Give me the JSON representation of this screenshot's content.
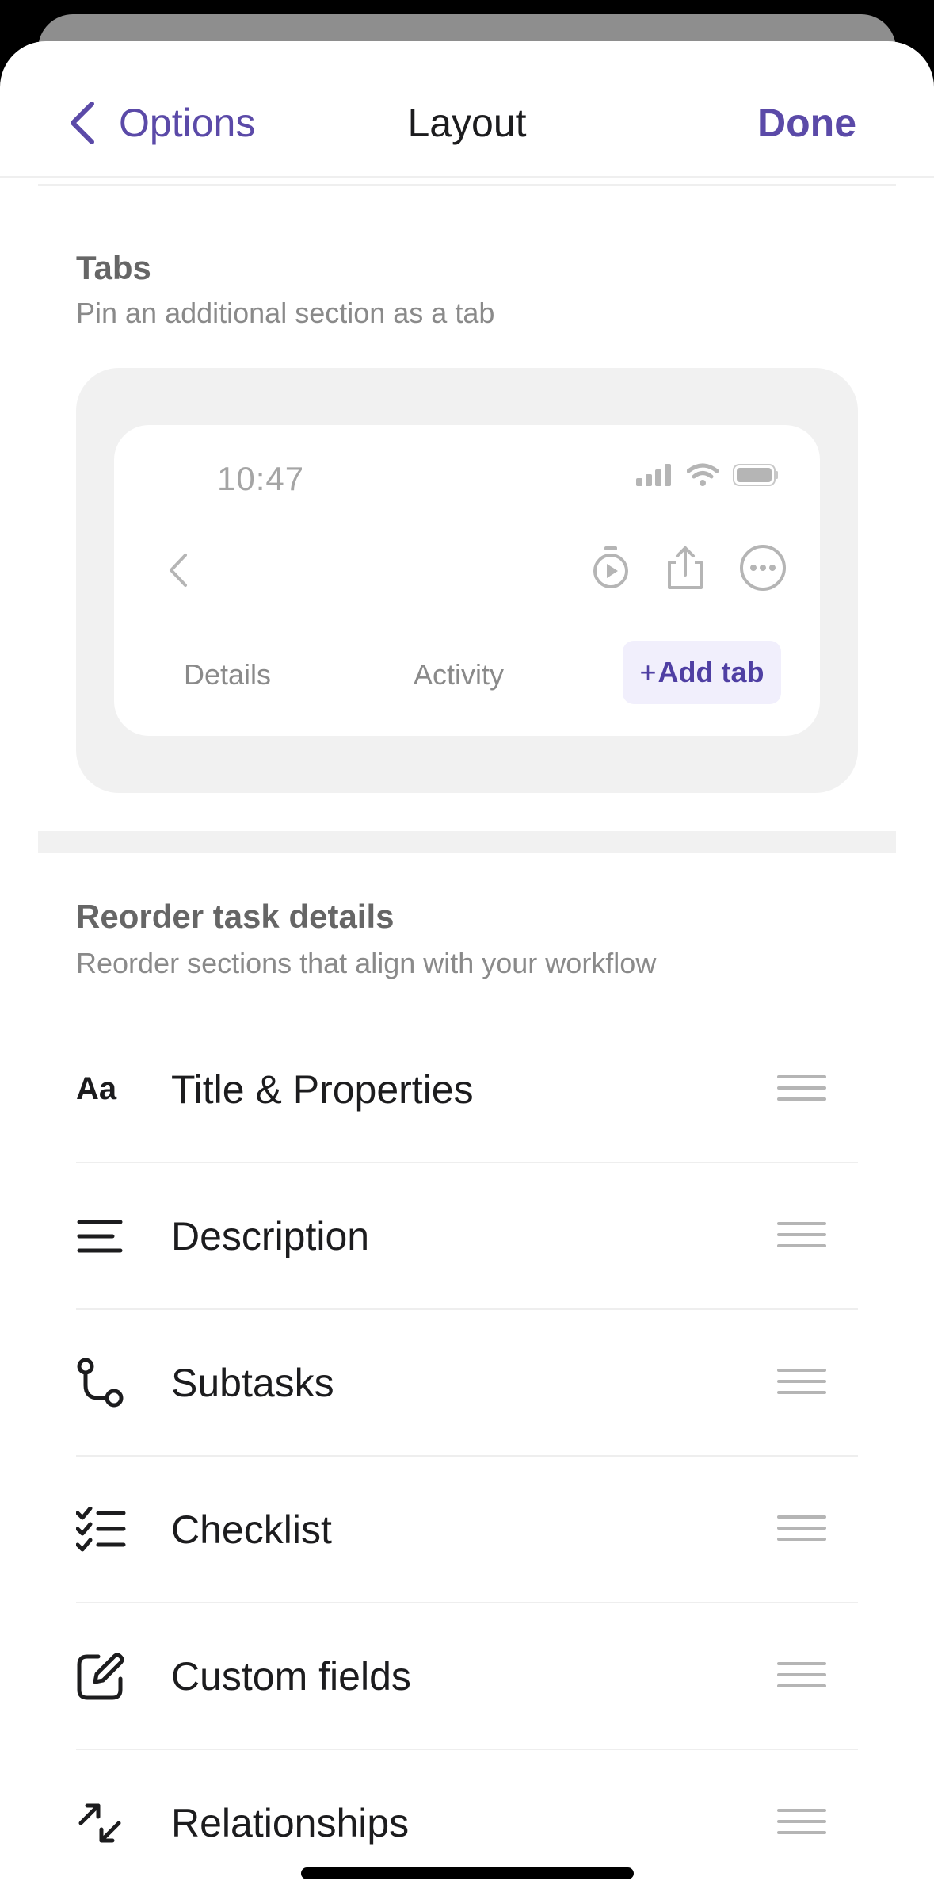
{
  "header": {
    "back_label": "Options",
    "title": "Layout",
    "done_label": "Done"
  },
  "tabs_section": {
    "title": "Tabs",
    "subtitle": "Pin an additional section as a tab",
    "preview": {
      "time": "10:47",
      "tabs": [
        "Details",
        "Activity"
      ],
      "add_tab_plus": "+",
      "add_tab_label": "Add tab"
    }
  },
  "reorder_section": {
    "title": "Reorder task details",
    "subtitle": "Reorder sections that align with your workflow",
    "items": [
      {
        "label": "Title & Properties",
        "icon": "text-aa-icon",
        "icon_text": "Aa"
      },
      {
        "label": "Description",
        "icon": "text-lines-icon"
      },
      {
        "label": "Subtasks",
        "icon": "subtask-branch-icon"
      },
      {
        "label": "Checklist",
        "icon": "checklist-icon"
      },
      {
        "label": "Custom fields",
        "icon": "edit-square-icon"
      },
      {
        "label": "Relationships",
        "icon": "relationship-arrows-icon"
      }
    ]
  },
  "colors": {
    "accent": "#5b4aa8",
    "add_tab_bg": "#f1effc",
    "section_bg": "#f1f1f1"
  }
}
